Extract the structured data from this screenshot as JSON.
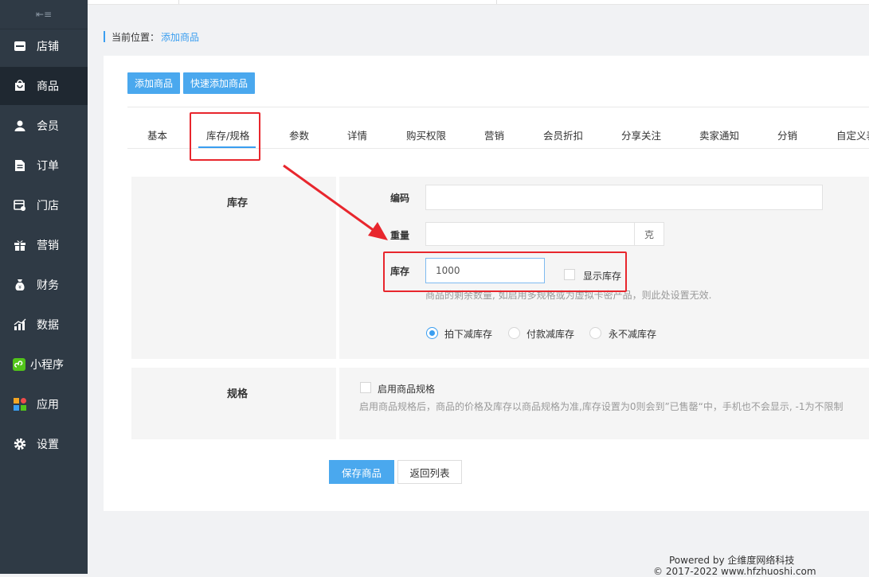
{
  "sidebar": {
    "items": [
      {
        "label": "店铺",
        "icon": "store-icon"
      },
      {
        "label": "商品",
        "icon": "goods-icon"
      },
      {
        "label": "会员",
        "icon": "user-icon"
      },
      {
        "label": "订单",
        "icon": "order-icon"
      },
      {
        "label": "门店",
        "icon": "shop-icon"
      },
      {
        "label": "营销",
        "icon": "gift-icon"
      },
      {
        "label": "财务",
        "icon": "money-bag-icon"
      },
      {
        "label": "数据",
        "icon": "chart-icon"
      },
      {
        "label": "小程序",
        "icon": "miniprogram-icon"
      },
      {
        "label": "应用",
        "icon": "apps-icon"
      },
      {
        "label": "设置",
        "icon": "gear-icon"
      }
    ],
    "active": "商品"
  },
  "breadcrumb": {
    "prefix": "当前位置：",
    "current": "添加商品"
  },
  "toolbar": {
    "add_label": "添加商品",
    "quick_add_label": "快速添加商品"
  },
  "tabs": [
    "基本",
    "库存/规格",
    "参数",
    "详情",
    "购买权限",
    "营销",
    "会员折扣",
    "分享关注",
    "卖家通知",
    "分销",
    "自定义表"
  ],
  "active_tab": "库存/规格",
  "stock_section": {
    "title": "库存",
    "code_label": "编码",
    "code_value": "",
    "weight_label": "重量",
    "weight_value": "",
    "weight_unit": "克",
    "stock_label": "库存",
    "stock_value": "1000",
    "show_stock_label": "显示库存",
    "hint": "商品的剩余数量, 如启用多规格或为虚拟卡密产品，则此处设置无效.",
    "reduce_options": [
      "拍下减库存",
      "付款减库存",
      "永不减库存"
    ],
    "reduce_selected": "拍下减库存"
  },
  "spec_section": {
    "title": "规格",
    "enable_label": "启用商品规格",
    "hint": "启用商品规格后，商品的价格及库存以商品规格为准,库存设置为0则会到”已售罄“中，手机也不会显示, -1为不限制"
  },
  "actions": {
    "save_label": "保存商品",
    "back_label": "返回列表"
  },
  "footer": {
    "powered": "Powered by 企维度网络科技",
    "copyright": "© 2017-2022 www.hfzhuoshi.com"
  },
  "colors": {
    "sidebar_bg": "#2f3a45",
    "accent": "#3a9ef0",
    "button": "#4aa8ee",
    "annotation_red": "#e8262d"
  }
}
